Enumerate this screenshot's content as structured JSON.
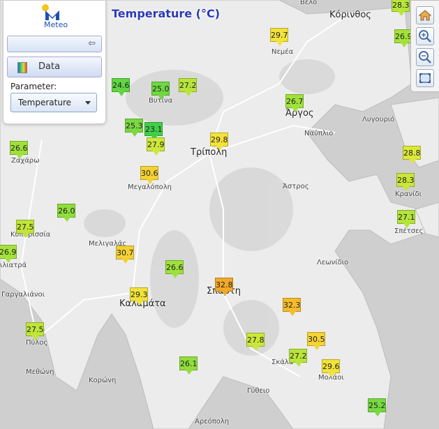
{
  "map": {
    "title": "Temperature (°C)",
    "parameter_label": "Parameter:",
    "parameter_value": "Temperature",
    "data_button_label": "Data",
    "logo_text": "Meteo",
    "place_names": {
      "velo": "Βέλο",
      "korinthos": "Κόρινθος",
      "nemea": "Νεμέα",
      "vytina": "Βυτίνα",
      "argos": "Άργος",
      "lygourio": "Λυγουριό",
      "nafplio": "Ναύπλιο",
      "tripoli": "Τρίπολη",
      "zacharo": "Ζαχάρω",
      "megalopoli": "Μεγαλόπολη",
      "kranidi": "Κρανίδι",
      "astros": "Άστρος",
      "spetses": "Σπέτσες",
      "kyparissia": "Κυπαρισσία",
      "meligalas": "Μελιγαλάς",
      "filiatra": "ιλιατρά",
      "leonidio": "Λεωνίδιο",
      "gargaliani": "Γαργαλιάνοι",
      "sparti": "Σπάρτη",
      "kalamata": "Καλαμάτα",
      "pylos": "Πύλος",
      "skala": "Σκάλα",
      "methoni": "Μεθώνη",
      "koroni": "Κορώνη",
      "molaoi": "Μολάοι",
      "gytheio": "Γύθειο",
      "areopoli": "Αρεόπολη"
    },
    "stations": [
      {
        "value": "28.3",
        "color": "#b7e63a"
      },
      {
        "value": "29.7",
        "color": "#f2e23a"
      },
      {
        "value": "26.9",
        "color": "#a4e23a"
      },
      {
        "value": "24.6",
        "color": "#5fd642"
      },
      {
        "value": "25.0",
        "color": "#6fd841"
      },
      {
        "value": "27.2",
        "color": "#b9e53a"
      },
      {
        "value": "26.7",
        "color": "#a0e23b"
      },
      {
        "value": "25.3",
        "color": "#79d940"
      },
      {
        "value": "23.1",
        "color": "#3fcf48"
      },
      {
        "value": "27.9",
        "color": "#cde83a"
      },
      {
        "value": "29.8",
        "color": "#f5e23a"
      },
      {
        "value": "26.6",
        "color": "#9fe13b"
      },
      {
        "value": "28.8",
        "color": "#dbe93a"
      },
      {
        "value": "30.6",
        "color": "#f4d234"
      },
      {
        "value": "28.3",
        "color": "#c9e63a"
      },
      {
        "value": "26.0",
        "color": "#8ede3c"
      },
      {
        "value": "27.1",
        "color": "#b3e43a"
      },
      {
        "value": "27.5",
        "color": "#c0e53a"
      },
      {
        "value": "26.9",
        "color": "#a4e23a"
      },
      {
        "value": "30.7",
        "color": "#f4d034"
      },
      {
        "value": "26.6",
        "color": "#9fe13b"
      },
      {
        "value": "29.3",
        "color": "#f0e23a"
      },
      {
        "value": "32.8",
        "color": "#f2a928"
      },
      {
        "value": "32.3",
        "color": "#f5bb2c"
      },
      {
        "value": "27.5",
        "color": "#c0e53a"
      },
      {
        "value": "27.8",
        "color": "#cce73a"
      },
      {
        "value": "30.5",
        "color": "#f4d335"
      },
      {
        "value": "27.2",
        "color": "#b9e53a"
      },
      {
        "value": "29.6",
        "color": "#f2e33a"
      },
      {
        "value": "26.1",
        "color": "#91de3c"
      },
      {
        "value": "25.2",
        "color": "#76d940"
      }
    ]
  },
  "toolbar": {
    "icons": [
      "home-icon",
      "zoom-in-icon",
      "zoom-out-icon",
      "fullscreen-icon"
    ]
  }
}
